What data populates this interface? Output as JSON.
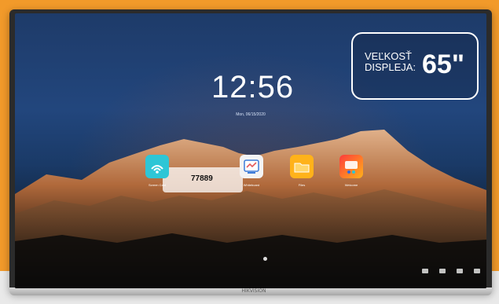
{
  "badge": {
    "line1": "VEĽKOSŤ",
    "line2": "DISPLEJA:",
    "size": "65\""
  },
  "screen": {
    "clock": "12:56",
    "date": "Mon, 06/15/2020",
    "apps": [
      {
        "label": "Screen Cast",
        "icon": "cast-icon",
        "color": "#2ec6d6"
      },
      {
        "label": "Whiteboard",
        "icon": "whiteboard-icon",
        "color": "#f3f3f3"
      },
      {
        "label": "Files",
        "icon": "folder-icon",
        "color": "#ffb21a"
      },
      {
        "label": "Welcome",
        "icon": "welcome-icon",
        "color": "#ff3b3b"
      }
    ],
    "screencast_code": "77889",
    "nav": [
      "nav-icon-1",
      "nav-icon-2",
      "nav-icon-3",
      "nav-icon-4"
    ]
  },
  "tv": {
    "brand": "HIKVISION"
  }
}
